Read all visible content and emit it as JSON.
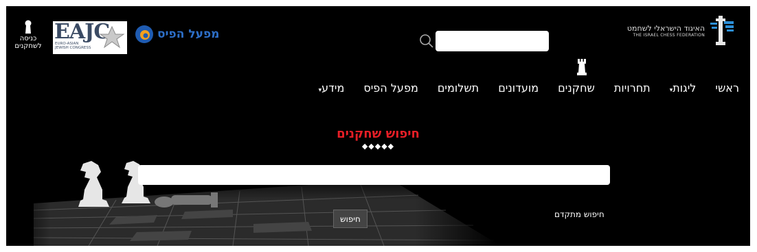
{
  "header": {
    "federation_logo": {
      "hebrew": "האיגוד הישראלי לשחמט",
      "english": "THE ISRAEL CHESS FEDERATION"
    },
    "search": {
      "placeholder": "",
      "value": ""
    },
    "login": {
      "label": "כניסה לשחקנים"
    },
    "eajc_logo": {
      "title": "EAJC",
      "subtitle_line1": "EURO-ASIAN",
      "subtitle_line2": "JEWISH CONGRESS"
    },
    "pais_logo": {
      "name": "מפעל הפיס"
    }
  },
  "nav": {
    "items": [
      {
        "label": "ראשי",
        "dropdown": false
      },
      {
        "label": "ליגות",
        "dropdown": true
      },
      {
        "label": "תחרויות",
        "dropdown": false
      },
      {
        "label": "שחקנים",
        "dropdown": false,
        "active": true
      },
      {
        "label": "מועדונים",
        "dropdown": false
      },
      {
        "label": "תשלומים",
        "dropdown": false
      },
      {
        "label": "מפעל הפיס",
        "dropdown": false
      },
      {
        "label": "מידע",
        "dropdown": true
      }
    ]
  },
  "player_search": {
    "title": "חיפוש שחקנים",
    "diamonds": "◆◆◆◆◆",
    "input_value": "",
    "advanced_search": "חיפוש מתקדם",
    "search_button": "חיפוש"
  },
  "colors": {
    "accent_red": "#e61e26",
    "background": "#000000",
    "pais_blue": "#2d6fc8"
  }
}
